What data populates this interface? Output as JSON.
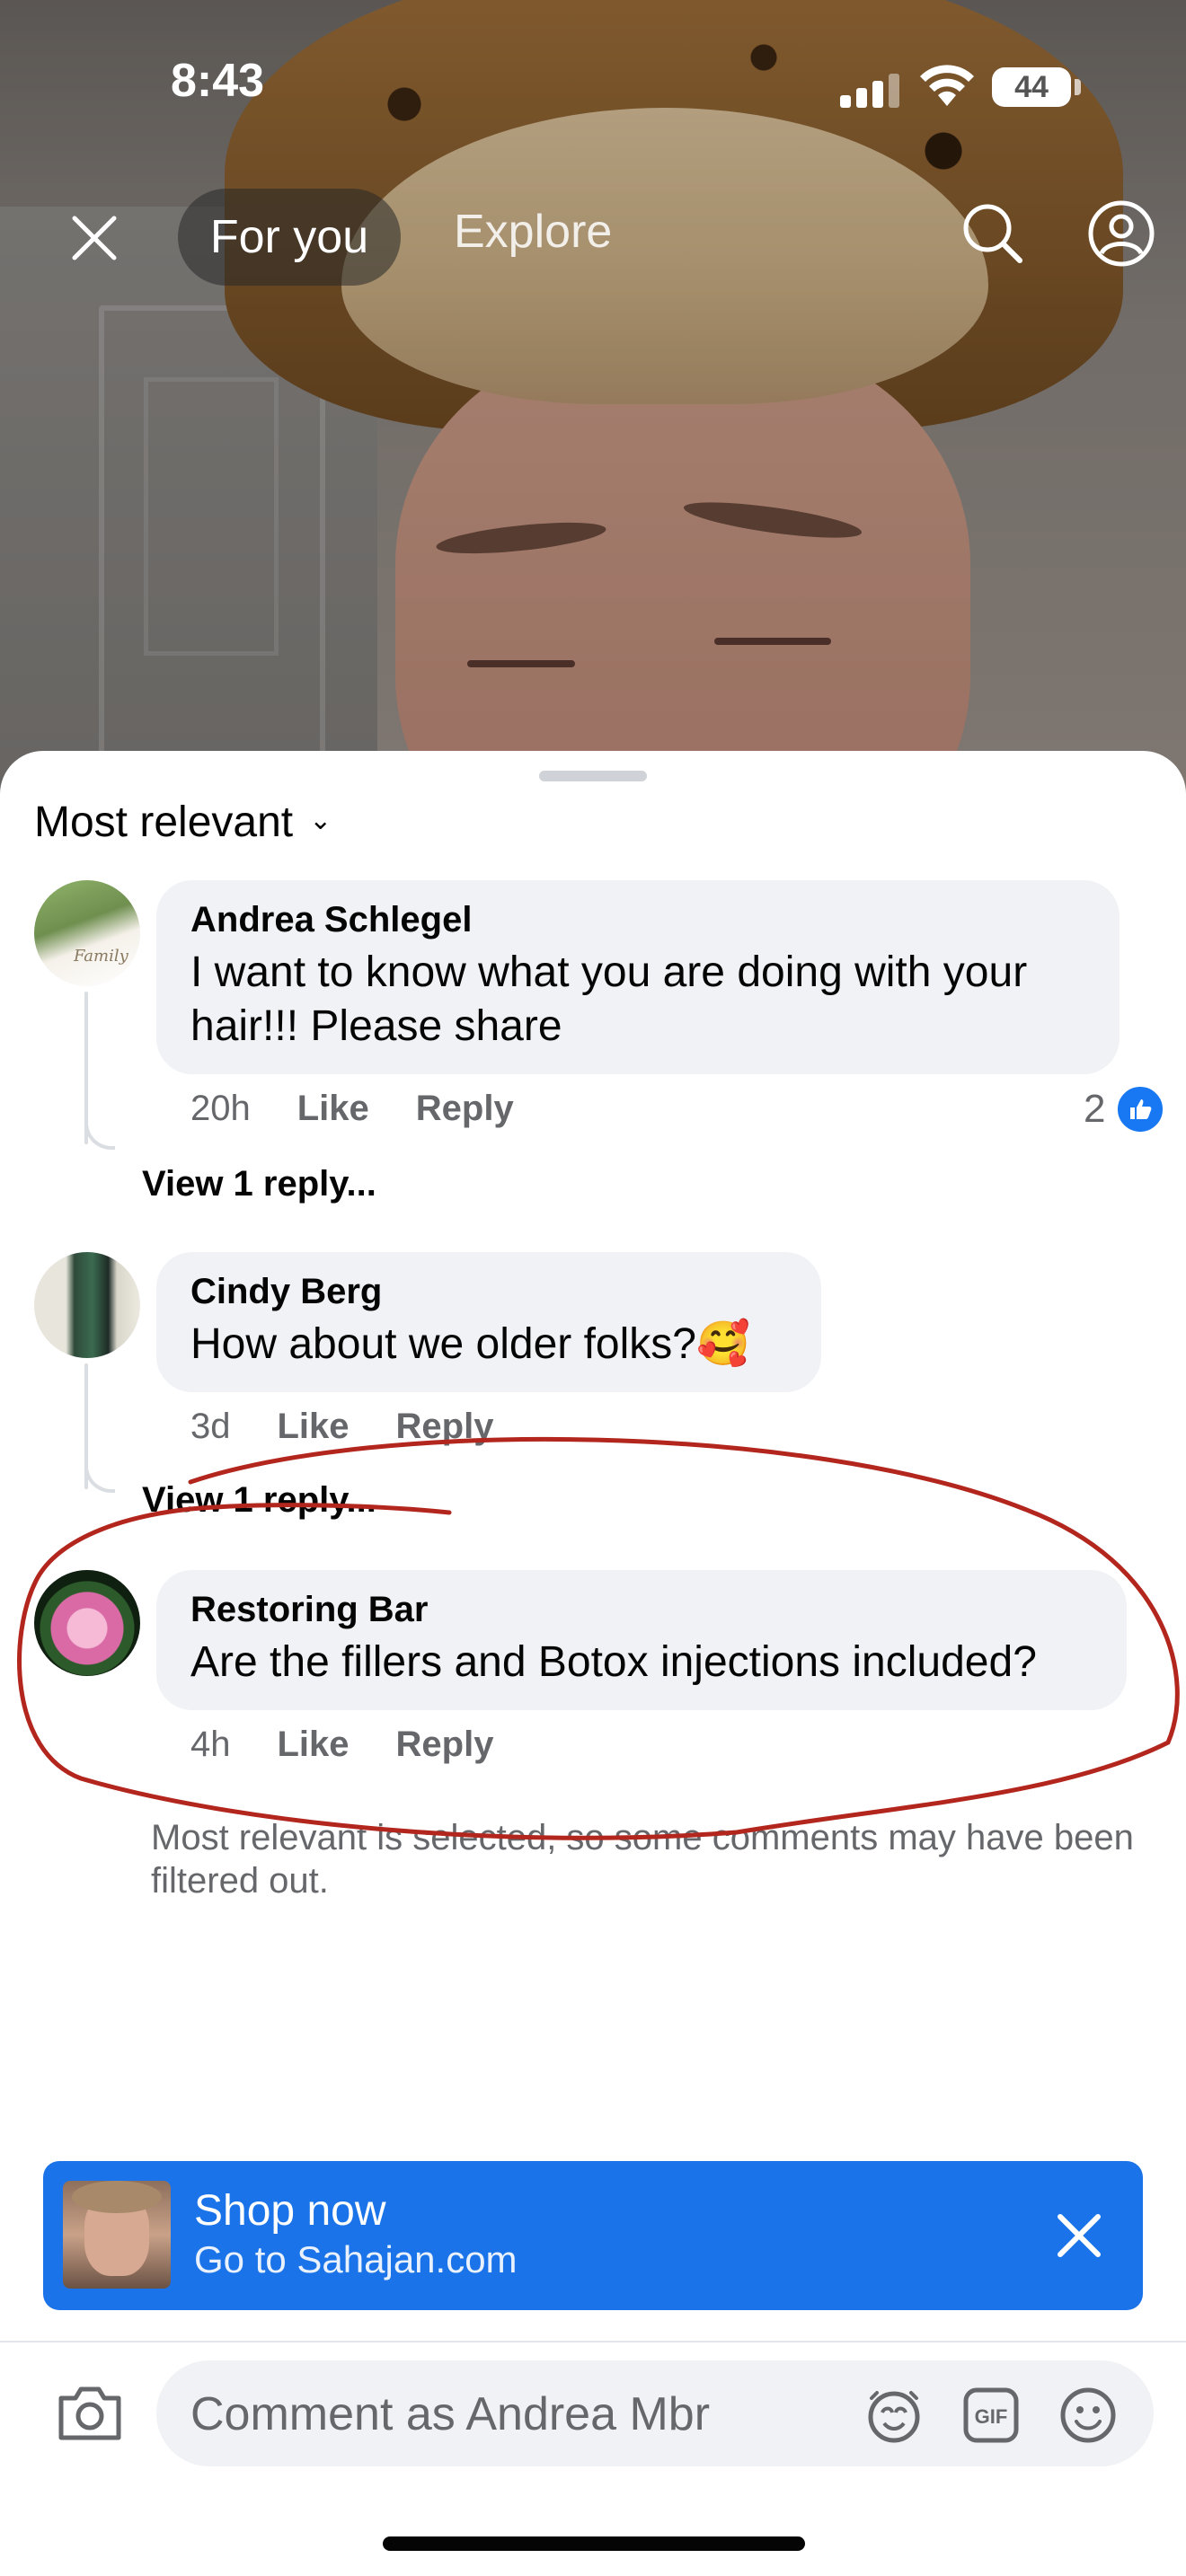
{
  "status_bar": {
    "time": "8:43",
    "battery": "44"
  },
  "top_nav": {
    "tab_active": "For you",
    "tab_other": "Explore"
  },
  "sheet": {
    "sort_label": "Most relevant"
  },
  "comments": [
    {
      "author": "Andrea Schlegel",
      "text": "I want to know what you are doing with your hair!!! Please share",
      "time": "20h",
      "like": "Like",
      "reply": "Reply",
      "reaction_count": "2",
      "view_replies": "View 1 reply..."
    },
    {
      "author": "Cindy Berg",
      "text": "How about we older folks?🥰",
      "time": "3d",
      "like": "Like",
      "reply": "Reply",
      "view_replies": "View 1 reply..."
    },
    {
      "author": "Restoring Bar",
      "text": "Are the fillers and Botox injections included?",
      "time": "4h",
      "like": "Like",
      "reply": "Reply"
    }
  ],
  "filter_note": "Most relevant is selected, so some comments may have been filtered out.",
  "ad": {
    "title": "Shop now",
    "subtitle": "Go to Sahajan.com"
  },
  "composer": {
    "placeholder": "Comment as Andrea Mbr"
  },
  "colors": {
    "accent": "#1877f2",
    "ad_bg": "#1a73e8",
    "annotation": "#b3261e",
    "bubble": "#f0f2f5"
  },
  "icons": [
    "close-icon",
    "search-icon",
    "profile-icon",
    "chevron-down-icon",
    "like-icon",
    "camera-icon",
    "avatar-sticker-icon",
    "gif-icon",
    "emoji-icon"
  ]
}
